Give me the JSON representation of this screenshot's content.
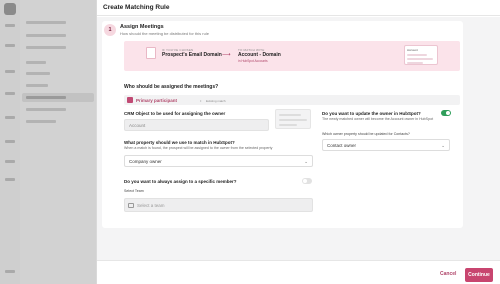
{
  "modal": {
    "title": "Create Matching Rule"
  },
  "step": {
    "number": "1",
    "title": "Assign Meetings",
    "subtitle": "How should the meeting be distributed for this rule"
  },
  "banner": {
    "left_label": "If you've chosen",
    "left_value": "Prospect's Email Domain",
    "right_label": "To match with",
    "right_value": "Account - Domain",
    "right_small": "in HubSpot Accounts",
    "mock_title": "Account"
  },
  "question_main": "Who should be assigned the meetings?",
  "participant": {
    "label": "Primary participant",
    "tag": "Existing match"
  },
  "crm_object": {
    "label": "CRM Object to be used for assigning the owner",
    "value": "Account"
  },
  "property": {
    "label": "What property should we use to match in HubSpot?",
    "help": "When a match is found, the prospect will be assigned to the owner from the selected property",
    "value": "Company owner"
  },
  "specific_member": {
    "label": "Do you want to always assign to a specific member?",
    "enabled": false
  },
  "select_team": {
    "label": "Select Team",
    "placeholder": "Select a team"
  },
  "update_owner": {
    "label": "Do you want to update the owner in HubSpot?",
    "help": "The newly matched owner will become the Account owner in HubSpot",
    "enabled": true
  },
  "owner_property": {
    "label": "Which owner property should be updated for Contacts?",
    "value": "Contact owner"
  },
  "footer": {
    "cancel": "Cancel",
    "continue": "Continue"
  },
  "colors": {
    "accent": "#c8456f",
    "toggle_on": "#2f9e5a",
    "banner_bg": "#fbe3ea"
  }
}
